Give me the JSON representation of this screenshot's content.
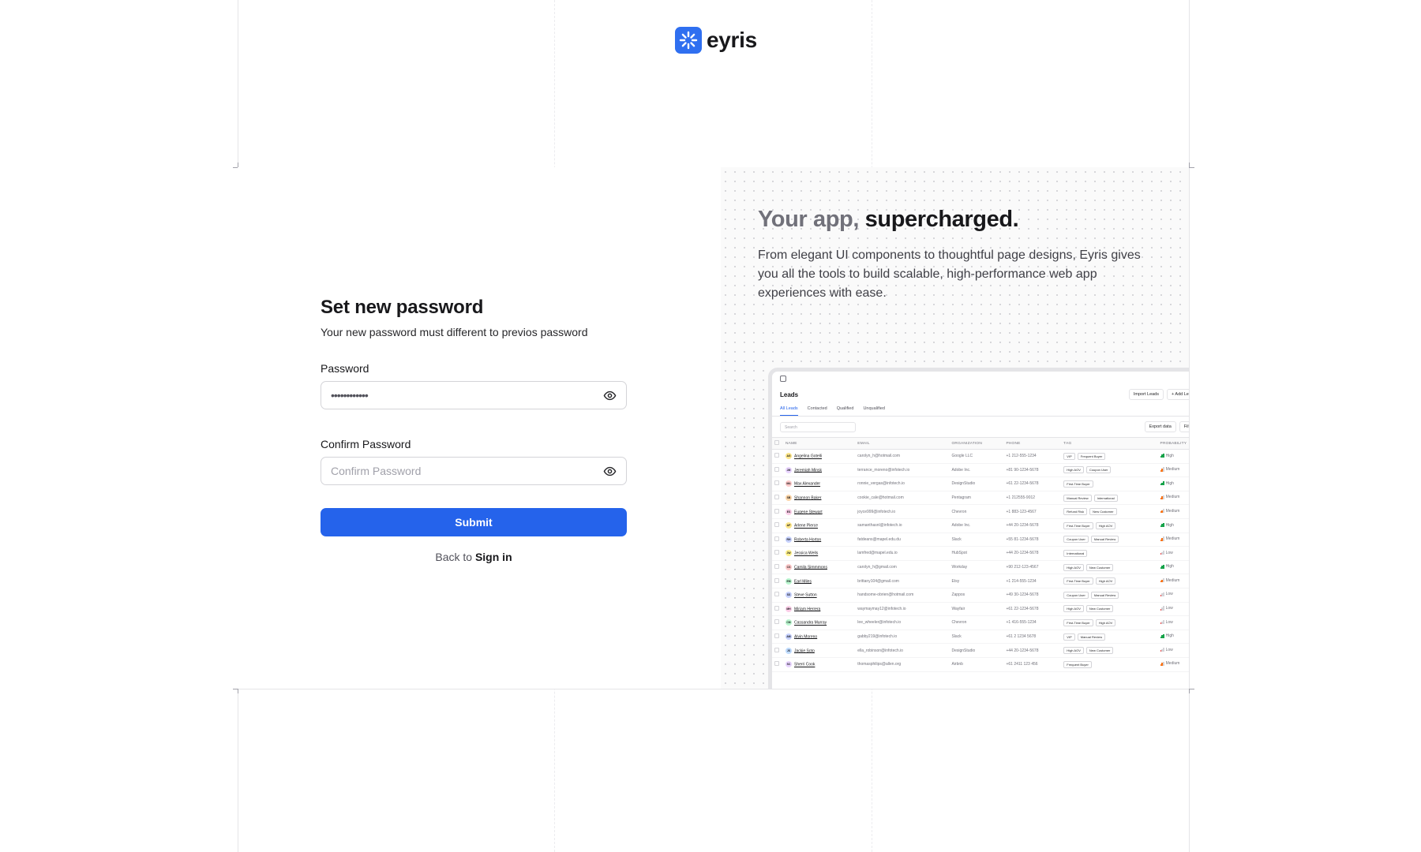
{
  "brand": {
    "name": "eyris",
    "accent": "#2f6ff0"
  },
  "form": {
    "title": "Set new password",
    "subtitle": "Your new password must different to previos password",
    "password_label": "Password",
    "password_value": "••••••••••••",
    "confirm_label": "Confirm Password",
    "confirm_placeholder": "Confirm Password",
    "submit_label": "Submit",
    "back_text": "Back to",
    "signin_label": "Sign in"
  },
  "hero": {
    "title_muted": "Your app,",
    "title_strong": "supercharged.",
    "description": "From elegant UI components to thoughtful page designs, Eyris gives you all the tools to build scalable, high-performance web app experiences with ease."
  },
  "preview": {
    "title": "Leads",
    "import_label": "Import Leads",
    "add_label": "+ Add Lead",
    "tabs": [
      "All Leads",
      "Contacted",
      "Qualified",
      "Unqualified"
    ],
    "search_placeholder": "Search",
    "export_label": "Export data",
    "filter_label": "Filter",
    "columns": [
      "NAME",
      "EMAIL",
      "ORGANIZATION",
      "PHONE",
      "TAG",
      "PROBABILITY"
    ],
    "rows": [
      {
        "initials": "AG",
        "color": "#fde68a",
        "name": "Angelina Gotelli",
        "email": "carolyn_h@hotmail.com",
        "org": "Google LLC",
        "phone": "+1 212-555-1234",
        "tags": [
          "VIP",
          "Frequent Buyer"
        ],
        "prob": "High"
      },
      {
        "initials": "JM",
        "color": "#e9d5ff",
        "name": "Jeremiah Minsk",
        "email": "terrance_moreno@infotech.io",
        "org": "Adobe Inc.",
        "phone": "+81 90-1234-5678",
        "tags": [
          "High AOV",
          "Coupon User"
        ],
        "prob": "Medium"
      },
      {
        "initials": "MA",
        "color": "#fecaca",
        "name": "Max Alexander",
        "email": "ronnie_vergas@infotech.io",
        "org": "DesignStudio",
        "phone": "+61 22-1234-5678",
        "tags": [
          "First-Time Buyer"
        ],
        "prob": "High"
      },
      {
        "initials": "SB",
        "color": "#fed7aa",
        "name": "Shannon Baker",
        "email": "cookie_cale@hotmail.com",
        "org": "Pentagram",
        "phone": "+1 212555-9012",
        "tags": [
          "Manual Review",
          "International"
        ],
        "prob": "Medium"
      },
      {
        "initials": "ES",
        "color": "#fbcfe8",
        "name": "Eugene Stewart",
        "email": "joyce999@infotech.io",
        "org": "Chevron",
        "phone": "+1 883-123-4567",
        "tags": [
          "Refund Risk",
          "New Customer"
        ],
        "prob": "Medium"
      },
      {
        "initials": "AP",
        "color": "#fde68a",
        "name": "Arlene Pierce",
        "email": "samanthasnl@infotech.io",
        "org": "Adobe Inc.",
        "phone": "+44 20-1234-5678",
        "tags": [
          "First-Time Buyer",
          "High AOV"
        ],
        "prob": "High"
      },
      {
        "initials": "RH",
        "color": "#c7d2fe",
        "name": "Roberta Horton",
        "email": "fatdeans@mapel.edu.du",
        "org": "Slack",
        "phone": "+55 81-1234-5678",
        "tags": [
          "Coupon User",
          "Manual Review"
        ],
        "prob": "Medium"
      },
      {
        "initials": "JW",
        "color": "#fef08a",
        "name": "Jessica Wells",
        "email": "lamfred@mapel.edu.io",
        "org": "HubSpot",
        "phone": "+44 20-1234-5678",
        "tags": [
          "International"
        ],
        "prob": "Low"
      },
      {
        "initials": "CS",
        "color": "#fecaca",
        "name": "Camila Simmmons",
        "email": "carolyn_h@gmail.com",
        "org": "Workday",
        "phone": "+90 212-123-4567",
        "tags": [
          "High AOV",
          "New Customer"
        ],
        "prob": "High"
      },
      {
        "initials": "EM",
        "color": "#bbf7d0",
        "name": "Earl Miles",
        "email": "brittany104@gmail.com",
        "org": "Etsy",
        "phone": "+1 214-555-1234",
        "tags": [
          "First-Time Buyer",
          "High AOV"
        ],
        "prob": "Medium"
      },
      {
        "initials": "SS",
        "color": "#c7d2fe",
        "name": "Steve Sutton",
        "email": "handsome-obrien@hotmail.com",
        "org": "Zappos",
        "phone": "+49 30-1234-5678",
        "tags": [
          "Coupon User",
          "Manual Review"
        ],
        "prob": "Low"
      },
      {
        "initials": "MH",
        "color": "#fbcfe8",
        "name": "Miriam Herrera",
        "email": "waymaymay12@infotech.io",
        "org": "Wayfair",
        "phone": "+61 22-1234-5678",
        "tags": [
          "High AOV",
          "New Customer"
        ],
        "prob": "Low"
      },
      {
        "initials": "CM",
        "color": "#bbf7d0",
        "name": "Cassandra Murray",
        "email": "lee_wheeler@infotech.io",
        "org": "Chevron",
        "phone": "+1 416-555-1234",
        "tags": [
          "First-Time Buyer",
          "High AOV"
        ],
        "prob": "Low"
      },
      {
        "initials": "AM",
        "color": "#c7d2fe",
        "name": "Alvin Moreno",
        "email": "gabby219@infotech.io",
        "org": "Slack",
        "phone": "+61 2 1234 5678",
        "tags": [
          "VIP",
          "Manual Review"
        ],
        "prob": "High"
      },
      {
        "initials": "JS",
        "color": "#bfdbfe",
        "name": "Jackie Soto",
        "email": "ella_robinson@infotech.io",
        "org": "DesignStudio",
        "phone": "+44 20-1234-5678",
        "tags": [
          "High AOV",
          "New Customer"
        ],
        "prob": "Low"
      },
      {
        "initials": "SC",
        "color": "#e9d5ff",
        "name": "Sherri Cook",
        "email": "thomasphilips@allen.org",
        "org": "Airbnb",
        "phone": "+61 2411 123 456",
        "tags": [
          "Frequent Buyer"
        ],
        "prob": "Medium"
      }
    ]
  }
}
